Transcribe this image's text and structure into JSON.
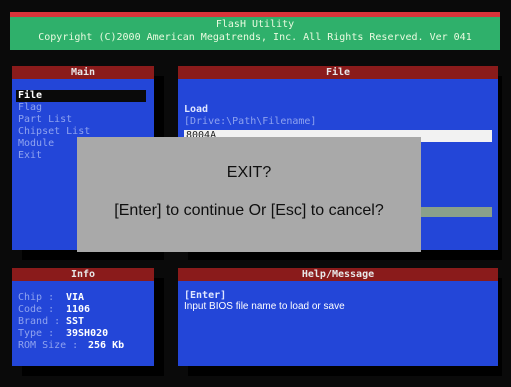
{
  "title_bar": {
    "app_name": "FlasH Utility",
    "copyright": "Copyright (C)2000 American Megatrends, Inc. All Rights Reserved. Ver 041"
  },
  "main_panel": {
    "header": "Main",
    "items": [
      "File",
      "Flag",
      "Part List",
      "Chipset List",
      "Module",
      "Exit"
    ],
    "selected": "File"
  },
  "file_panel": {
    "header": "File",
    "load_label": "Load",
    "path_hint": "[Drive:\\Path\\Filename]",
    "input_value": "8004A"
  },
  "dialog": {
    "title": "EXIT?",
    "message": "[Enter] to continue Or [Esc] to cancel?"
  },
  "info_panel": {
    "header": "Info",
    "rows": [
      {
        "label": "Chip   :",
        "value": "VIA"
      },
      {
        "label": "Code   :",
        "value": "1106"
      },
      {
        "label": "Brand  :",
        "value": "SST"
      },
      {
        "label": "Type   :",
        "value": "39SH020"
      },
      {
        "label": "ROM Size :",
        "value": "256 Kb"
      }
    ]
  },
  "help_panel": {
    "header": "Help/Message",
    "key": "[Enter]",
    "text": "Input BIOS file name to load or save"
  }
}
